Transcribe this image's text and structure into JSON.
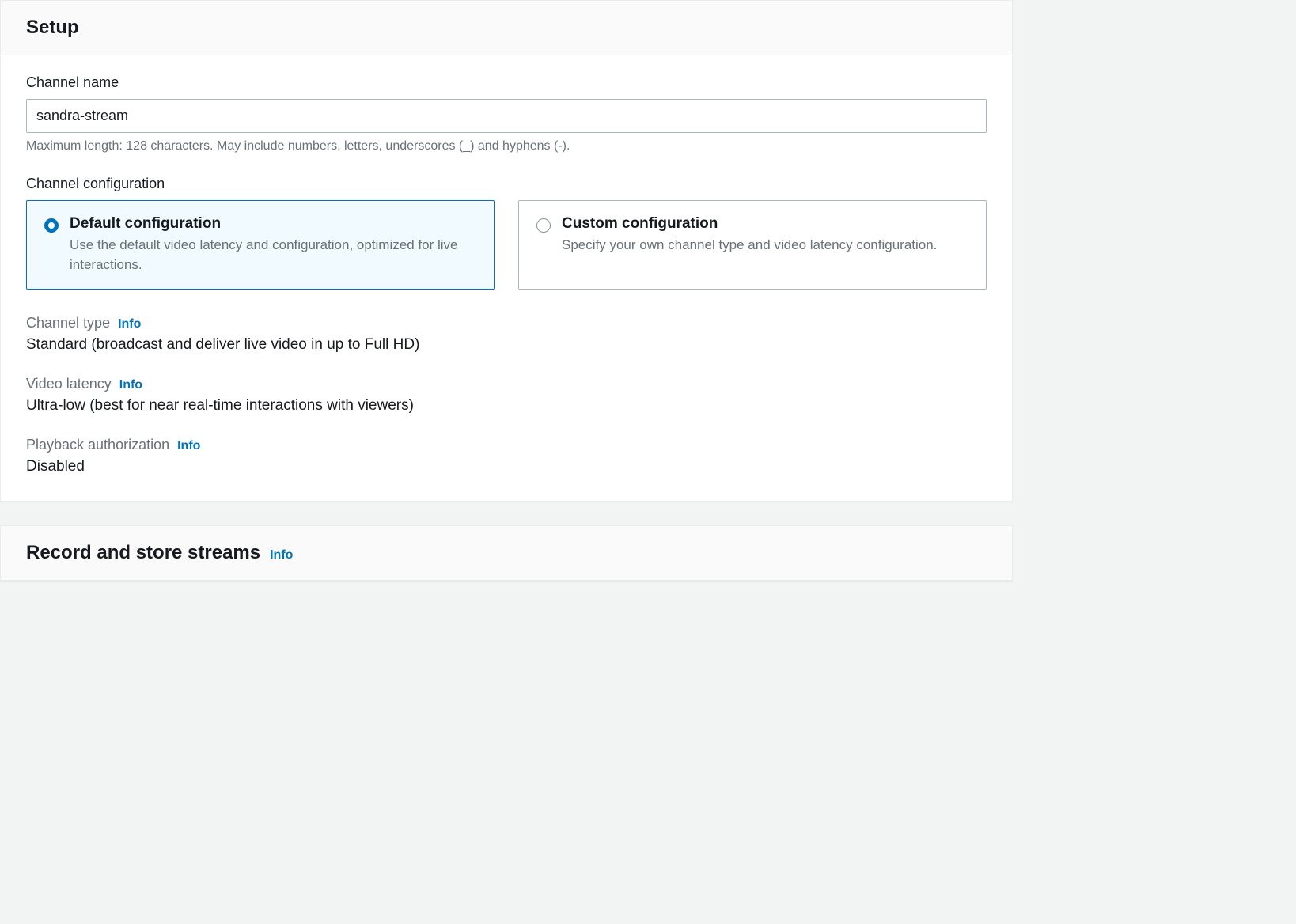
{
  "setup": {
    "panelTitle": "Setup",
    "channelName": {
      "label": "Channel name",
      "value": "sandra-stream",
      "helper": "Maximum length: 128 characters. May include numbers, letters, underscores (_) and hyphens (-)."
    },
    "channelConfig": {
      "label": "Channel configuration",
      "options": [
        {
          "title": "Default configuration",
          "description": "Use the default video latency and configuration, optimized for live interactions.",
          "selected": true
        },
        {
          "title": "Custom configuration",
          "description": "Specify your own channel type and video latency configuration.",
          "selected": false
        }
      ]
    },
    "details": {
      "channelType": {
        "label": "Channel type",
        "infoLabel": "Info",
        "value": "Standard (broadcast and deliver live video in up to Full HD)"
      },
      "videoLatency": {
        "label": "Video latency",
        "infoLabel": "Info",
        "value": "Ultra-low (best for near real-time interactions with viewers)"
      },
      "playbackAuth": {
        "label": "Playback authorization",
        "infoLabel": "Info",
        "value": "Disabled"
      }
    }
  },
  "record": {
    "panelTitle": "Record and store streams",
    "infoLabel": "Info"
  }
}
